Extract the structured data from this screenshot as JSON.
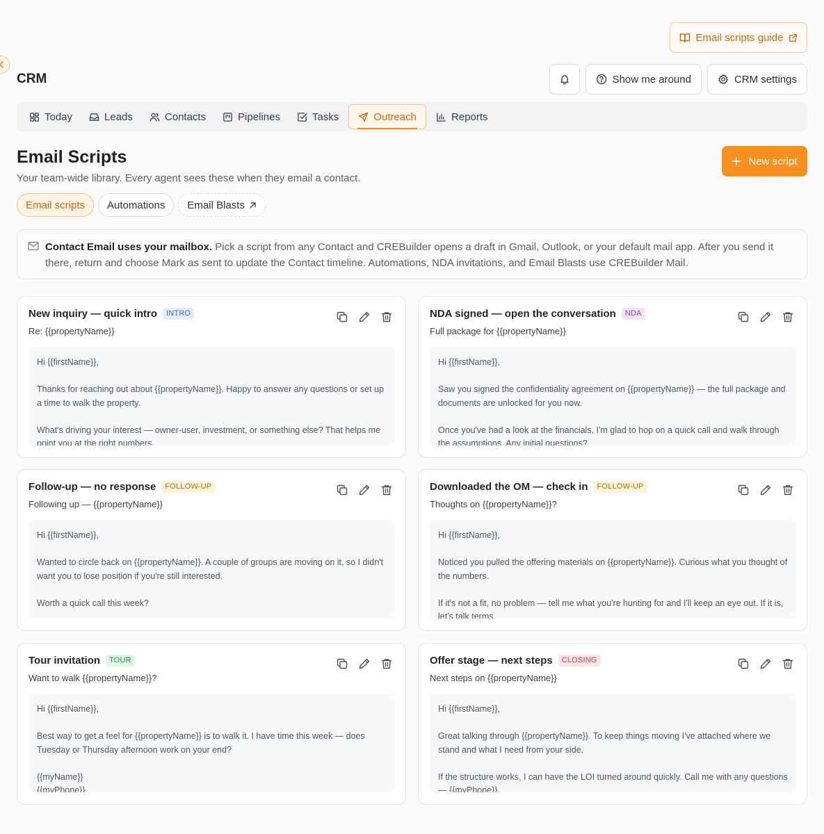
{
  "header": {
    "app_title": "CRM",
    "guide_label": "Email scripts guide",
    "tour_label": "Show me around",
    "settings_label": "CRM settings"
  },
  "tabs": [
    {
      "label": "Today",
      "icon": "dashboard-icon"
    },
    {
      "label": "Leads",
      "icon": "inbox-icon"
    },
    {
      "label": "Contacts",
      "icon": "users-icon"
    },
    {
      "label": "Pipelines",
      "icon": "kanban-icon"
    },
    {
      "label": "Tasks",
      "icon": "checkbox-icon"
    },
    {
      "label": "Outreach",
      "icon": "send-icon",
      "active": true
    },
    {
      "label": "Reports",
      "icon": "bar-chart-icon"
    }
  ],
  "page": {
    "title": "Email Scripts",
    "subtitle": "Your team-wide library. Every agent sees these when they email a contact.",
    "new_button": "New script"
  },
  "subtabs": [
    {
      "label": "Email scripts",
      "active": true
    },
    {
      "label": "Automations"
    },
    {
      "label": "Email Blasts"
    }
  ],
  "notice": {
    "bold": "Contact Email uses your mailbox.",
    "text": " Pick a script from any Contact and CREBuilder opens a draft in Gmail, Outlook, or your default mail app. After you send it there, return and choose Mark as sent to update the Contact timeline. Automations, NDA invitations, and Email Blasts use CREBuilder Mail."
  },
  "colors": {
    "accent": "#f7901e",
    "accent_text": "#c96a12"
  },
  "scripts": [
    {
      "title": "New inquiry — quick intro",
      "badge": "INTRO",
      "subject": "Re: {{propertyName}}",
      "body": [
        "Hi {{firstName}},",
        "Thanks for reaching out about {{propertyName}}. Happy to answer any questions or set up a time to walk the property.",
        "What's driving your interest — owner-user, investment, or something else? That helps me point you at the right numbers."
      ]
    },
    {
      "title": "NDA signed — open the conversation",
      "badge": "NDA",
      "subject": "Full package for {{propertyName}}",
      "body": [
        "Hi {{firstName}},",
        "Saw you signed the confidentiality agreement on {{propertyName}} — the full package and documents are unlocked for you now.",
        "Once you've had a look at the financials, I'm glad to hop on a quick call and walk through the assumptions. Any initial questions?"
      ]
    },
    {
      "title": "Follow-up — no response",
      "badge": "FOLLOW-UP",
      "subject": "Following up — {{propertyName}}",
      "body": [
        "Hi {{firstName}},",
        "Wanted to circle back on {{propertyName}}. A couple of groups are moving on it, so I didn't want you to lose position if you're still interested.",
        "Worth a quick call this week?"
      ]
    },
    {
      "title": "Downloaded the OM — check in",
      "badge": "FOLLOW-UP",
      "subject": "Thoughts on {{propertyName}}?",
      "body": [
        "Hi {{firstName}},",
        "Noticed you pulled the offering materials on {{propertyName}}. Curious what you thought of the numbers.",
        "If it's not a fit, no problem — tell me what you're hunting for and I'll keep an eye out. If it is, let's talk terms."
      ]
    },
    {
      "title": "Tour invitation",
      "badge": "TOUR",
      "subject": "Want to walk {{propertyName}}?",
      "body": [
        "Hi {{firstName}},",
        "Best way to get a feel for {{propertyName}} is to walk it. I have time this week — does Tuesday or Thursday afternoon work on your end?",
        "{{myName}}\n{{myPhone}}"
      ]
    },
    {
      "title": "Offer stage — next steps",
      "badge": "CLOSING",
      "subject": "Next steps on {{propertyName}}",
      "body": [
        "Hi {{firstName}},",
        "Great talking through {{propertyName}}. To keep things moving I've attached where we stand and what I need from your side.",
        "If the structure works, I can have the LOI turned around quickly. Call me with any questions — {{myPhone}}."
      ]
    }
  ]
}
